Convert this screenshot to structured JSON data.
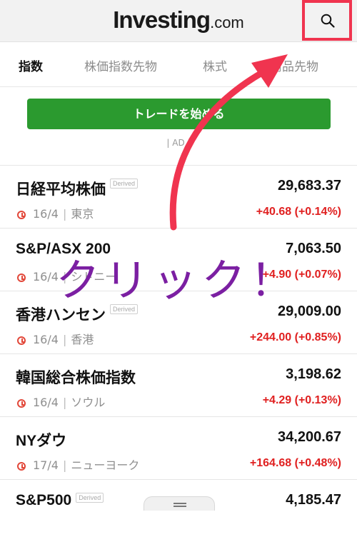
{
  "header": {
    "logo_main": "Investing",
    "logo_domain": ".com",
    "search_icon": "search-icon",
    "highlight_color": "#f0344f"
  },
  "tabs": [
    {
      "label": "指数",
      "active": true
    },
    {
      "label": "株価指数先物",
      "active": false
    },
    {
      "label": "株式",
      "active": false
    },
    {
      "label": "商品先物",
      "active": false
    }
  ],
  "trade_button": {
    "label": "トレードを始める",
    "color": "#2b9a2f"
  },
  "ad_label": "| AD |",
  "badge_label": "Derived",
  "indices": [
    {
      "name": "日経平均株価",
      "derived": true,
      "price": "29,683.37",
      "date": "16/4",
      "location": "東京",
      "change": "+40.68 (+0.14%)"
    },
    {
      "name": "S&P/ASX 200",
      "derived": false,
      "price": "7,063.50",
      "date": "16/4",
      "location": "シドニー",
      "change": "+4.90 (+0.07%)"
    },
    {
      "name": "香港ハンセン",
      "derived": true,
      "price": "29,009.00",
      "date": "16/4",
      "location": "香港",
      "change": "+244.00 (+0.85%)"
    },
    {
      "name": "韓国総合株価指数",
      "derived": false,
      "price": "3,198.62",
      "date": "16/4",
      "location": "ソウル",
      "change": "+4.29 (+0.13%)"
    },
    {
      "name": "NYダウ",
      "derived": false,
      "price": "34,200.67",
      "date": "17/4",
      "location": "ニューヨーク",
      "change": "+164.68 (+0.48%)"
    },
    {
      "name": "S&P500",
      "derived": true,
      "price": "4,185.47",
      "date": "",
      "location": "",
      "change": ""
    }
  ],
  "annotation": {
    "text": "クリック！",
    "text_color": "#7b1fa2",
    "arrow_color": "#f0344f"
  },
  "colors": {
    "positive_change": "#e02020",
    "clock": "#e2483a"
  }
}
